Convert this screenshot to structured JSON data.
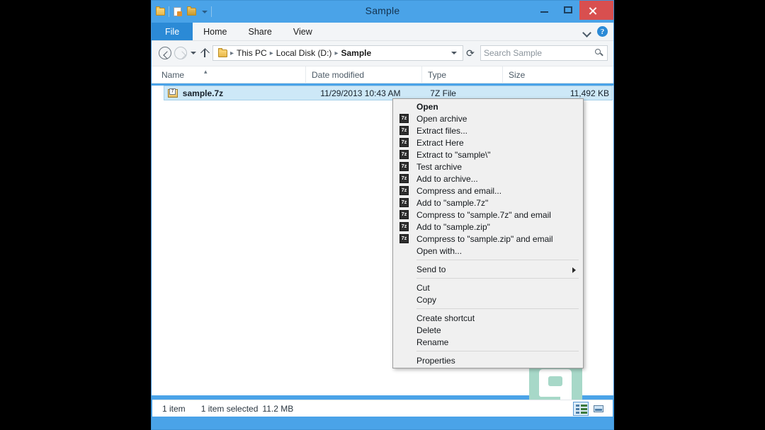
{
  "window": {
    "title": "Sample",
    "quick_access": [
      "folder-icon",
      "save-icon",
      "folder-properties-icon",
      "customize-caret-icon"
    ],
    "buttons": {
      "minimize": "minimize-button",
      "maximize": "maximize-button",
      "close": "close-button"
    }
  },
  "ribbon": {
    "tabs": [
      {
        "label": "File",
        "active": true
      },
      {
        "label": "Home",
        "active": false
      },
      {
        "label": "Share",
        "active": false
      },
      {
        "label": "View",
        "active": false
      }
    ],
    "expand_label": "",
    "help_label": "?"
  },
  "addressbar": {
    "back": "back-button",
    "forward": "forward-button",
    "recent": "recent-locations-button",
    "up": "up-button",
    "breadcrumbs": [
      {
        "label": "This PC",
        "bold": false
      },
      {
        "label": "Local Disk (D:)",
        "bold": false
      },
      {
        "label": "Sample",
        "bold": true
      }
    ],
    "separator": "▸",
    "refresh_glyph": "⟳",
    "search": {
      "placeholder": "Search Sample",
      "value": ""
    }
  },
  "columns": [
    {
      "label": "Name",
      "sorted": true,
      "sort_glyph": "▴"
    },
    {
      "label": "Date modified",
      "sorted": false
    },
    {
      "label": "Type",
      "sorted": false
    },
    {
      "label": "Size",
      "sorted": false
    }
  ],
  "files": [
    {
      "name": "sample.7z",
      "date_modified": "11/29/2013 10:43 AM",
      "type": "7Z File",
      "size": "11,492 KB",
      "icon_label": "7",
      "selected": true
    }
  ],
  "statusbar": {
    "item_count": "1 item",
    "selection": "1 item selected",
    "selection_size": "11.2 MB",
    "views": [
      {
        "name": "details-view-button",
        "selected": true
      },
      {
        "name": "large-icons-view-button",
        "selected": false
      }
    ]
  },
  "context_menu": {
    "icon_label": "7z",
    "groups": [
      {
        "items": [
          {
            "label": "Open",
            "icon": false,
            "bold": true,
            "submenu": false
          },
          {
            "label": "Open archive",
            "icon": true,
            "bold": false,
            "submenu": false
          },
          {
            "label": "Extract files...",
            "icon": true,
            "bold": false,
            "submenu": false
          },
          {
            "label": "Extract Here",
            "icon": true,
            "bold": false,
            "submenu": false
          },
          {
            "label": "Extract to \"sample\\\"",
            "icon": true,
            "bold": false,
            "submenu": false
          },
          {
            "label": "Test archive",
            "icon": true,
            "bold": false,
            "submenu": false
          },
          {
            "label": "Add to archive...",
            "icon": true,
            "bold": false,
            "submenu": false
          },
          {
            "label": "Compress and email...",
            "icon": true,
            "bold": false,
            "submenu": false
          },
          {
            "label": "Add to \"sample.7z\"",
            "icon": true,
            "bold": false,
            "submenu": false
          },
          {
            "label": "Compress to \"sample.7z\" and email",
            "icon": true,
            "bold": false,
            "submenu": false
          },
          {
            "label": "Add to \"sample.zip\"",
            "icon": true,
            "bold": false,
            "submenu": false
          },
          {
            "label": "Compress to \"sample.zip\" and email",
            "icon": true,
            "bold": false,
            "submenu": false
          },
          {
            "label": "Open with...",
            "icon": false,
            "bold": false,
            "submenu": false
          }
        ]
      },
      {
        "items": [
          {
            "label": "Send to",
            "icon": false,
            "bold": false,
            "submenu": true
          }
        ]
      },
      {
        "items": [
          {
            "label": "Cut",
            "icon": false,
            "bold": false,
            "submenu": false
          },
          {
            "label": "Copy",
            "icon": false,
            "bold": false,
            "submenu": false
          }
        ]
      },
      {
        "items": [
          {
            "label": "Create shortcut",
            "icon": false,
            "bold": false,
            "submenu": false
          },
          {
            "label": "Delete",
            "icon": false,
            "bold": false,
            "submenu": false
          },
          {
            "label": "Rename",
            "icon": false,
            "bold": false,
            "submenu": false
          }
        ]
      },
      {
        "items": [
          {
            "label": "Properties",
            "icon": false,
            "bold": false,
            "submenu": false
          }
        ]
      }
    ]
  },
  "colors": {
    "titlebar": "#4aa3e8",
    "accent": "#2b8ad6",
    "close": "#d84f4f",
    "selection": "#cde8f7",
    "menu_bg": "#f0f0f0",
    "watermark": "#a7d8c8"
  }
}
